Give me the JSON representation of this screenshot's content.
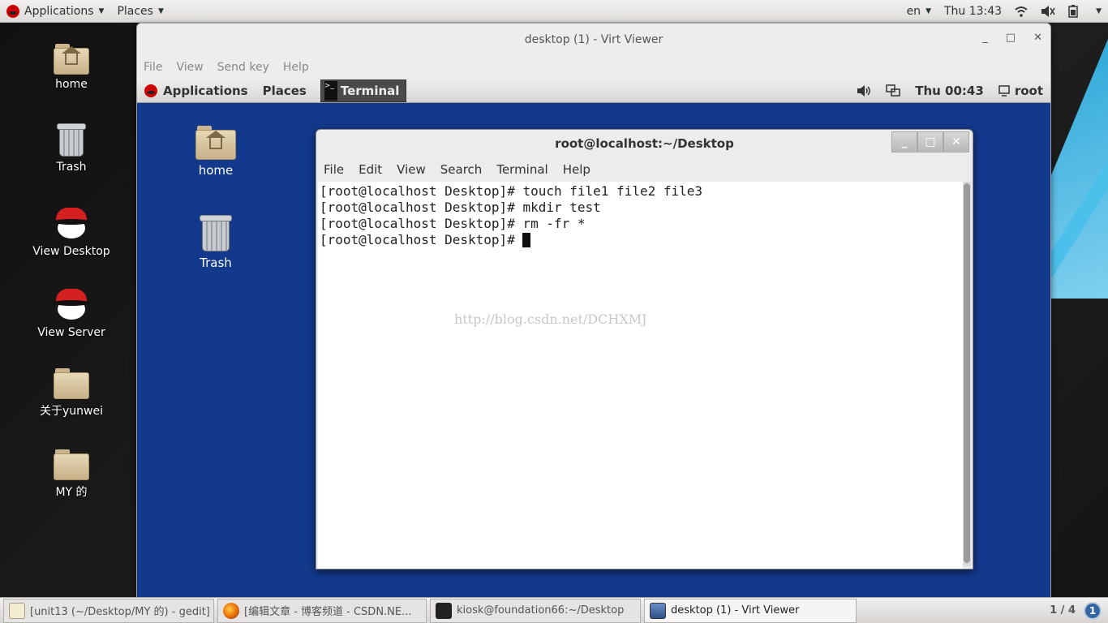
{
  "host_panel": {
    "applications": "Applications",
    "places": "Places",
    "lang": "en",
    "clock": "Thu 13:43"
  },
  "host_desktop_icons": [
    "home",
    "Trash",
    "View Desktop",
    "View Server",
    "关于yunwei",
    "MY 的"
  ],
  "virt_viewer": {
    "title": "desktop (1) - Virt Viewer",
    "menu": [
      "File",
      "View",
      "Send key",
      "Help"
    ]
  },
  "guest_panel": {
    "applications": "Applications",
    "places": "Places",
    "terminal": "Terminal",
    "clock": "Thu 00:43",
    "user": "root"
  },
  "guest_desktop_icons": [
    "home",
    "Trash"
  ],
  "terminal": {
    "title": "root@localhost:~/Desktop",
    "menu": [
      "File",
      "Edit",
      "View",
      "Search",
      "Terminal",
      "Help"
    ],
    "lines": [
      "[root@localhost Desktop]# touch file1 file2 file3",
      "[root@localhost Desktop]# mkdir test",
      "[root@localhost Desktop]# rm -fr *",
      "[root@localhost Desktop]# "
    ],
    "watermark": "http://blog.csdn.net/DCHXMJ"
  },
  "taskbar": {
    "tasks": [
      "[unit13 (~/Desktop/MY 的) - gedit]",
      "[编辑文章 - 博客频道 - CSDN.NE...",
      "kiosk@foundation66:~/Desktop",
      "desktop (1) - Virt Viewer"
    ],
    "workspace": "1 / 4",
    "badge": "1"
  },
  "colors": {
    "guest_bg": "#13398c",
    "panel_bg": "#ededed",
    "accent_blue": "#2aa6d8"
  }
}
